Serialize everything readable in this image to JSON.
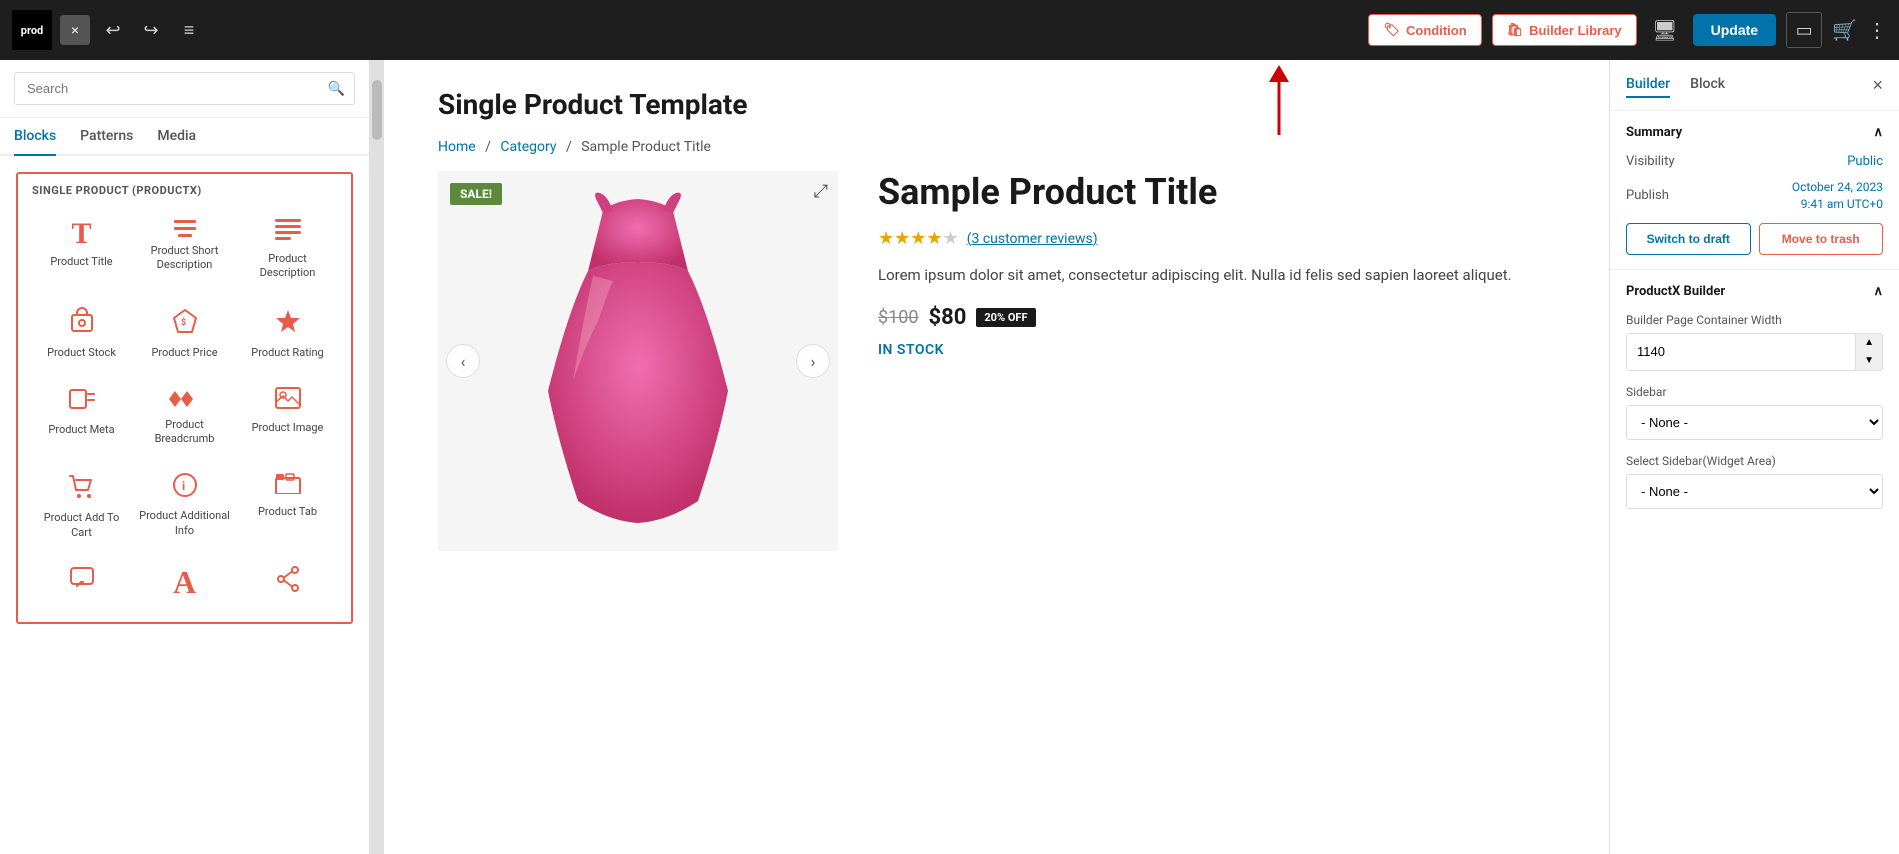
{
  "toolbar": {
    "logo": "prod",
    "close_label": "×",
    "undo_icon": "↩",
    "redo_icon": "↪",
    "list_icon": "≡",
    "condition_label": "Condition",
    "builder_library_label": "Builder Library",
    "monitor_icon": "🖥",
    "update_label": "Update",
    "sidebar_toggle_icon": "⬜",
    "cart_icon": "🛒",
    "more_icon": "⋮"
  },
  "left_panel": {
    "search_placeholder": "Search",
    "tabs": [
      "Blocks",
      "Patterns",
      "Media"
    ],
    "active_tab": "Blocks",
    "section_label": "SINGLE PRODUCT (PRODUCTX)",
    "blocks": [
      {
        "id": "product-title",
        "label": "Product Title",
        "icon": "T"
      },
      {
        "id": "product-short-desc",
        "label": "Product Short Description",
        "icon": "≡"
      },
      {
        "id": "product-description",
        "label": "Product Description",
        "icon": "☰"
      },
      {
        "id": "product-stock",
        "label": "Product Stock",
        "icon": "📦"
      },
      {
        "id": "product-price",
        "label": "Product Price",
        "icon": "🏷"
      },
      {
        "id": "product-rating",
        "label": "Product Rating",
        "icon": "★"
      },
      {
        "id": "product-meta",
        "label": "Product Meta",
        "icon": "📋"
      },
      {
        "id": "product-breadcrumb",
        "label": "Product Breadcrumb",
        "icon": "▶▶"
      },
      {
        "id": "product-image",
        "label": "Product Image",
        "icon": "🖼"
      },
      {
        "id": "product-add-to-cart",
        "label": "Product Add To Cart",
        "icon": "🛒"
      },
      {
        "id": "product-additional-info",
        "label": "Product Additional Info",
        "icon": "ℹ"
      },
      {
        "id": "product-tab",
        "label": "Product Tab",
        "icon": "☰"
      },
      {
        "id": "block-13",
        "label": "",
        "icon": "💬"
      },
      {
        "id": "block-14",
        "label": "",
        "icon": "A"
      },
      {
        "id": "block-15",
        "label": "",
        "icon": "↗"
      }
    ]
  },
  "canvas": {
    "page_title": "Single Product Template",
    "breadcrumb": {
      "home": "Home",
      "category": "Category",
      "current": "Sample Product Title"
    },
    "product": {
      "sale_badge": "SALE!",
      "title": "Sample Product Title",
      "rating": 4,
      "max_rating": 5,
      "review_count": "3 customer reviews",
      "description": "Lorem ipsum dolor sit amet, consectetur adipiscing elit. Nulla id felis sed sapien laoreet aliquet.",
      "price_old": "$100",
      "price_new": "$80",
      "discount": "20% OFF",
      "stock": "IN STOCK"
    }
  },
  "right_panel": {
    "tabs": [
      "Builder",
      "Block"
    ],
    "active_tab": "Builder",
    "close_icon": "×",
    "summary_label": "Summary",
    "visibility_label": "Visibility",
    "visibility_value": "Public",
    "publish_label": "Publish",
    "publish_date": "October 24, 2023",
    "publish_time": "9:41 am UTC+0",
    "switch_to_draft": "Switch to draft",
    "move_to_trash": "Move to trash",
    "productx_builder_label": "ProductX Builder",
    "container_width_label": "Builder Page Container Width",
    "container_width_value": "1140",
    "sidebar_label": "Sidebar",
    "sidebar_value": "- None -",
    "select_sidebar_label": "Select Sidebar(Widget Area)",
    "select_sidebar_value": "- None -"
  }
}
